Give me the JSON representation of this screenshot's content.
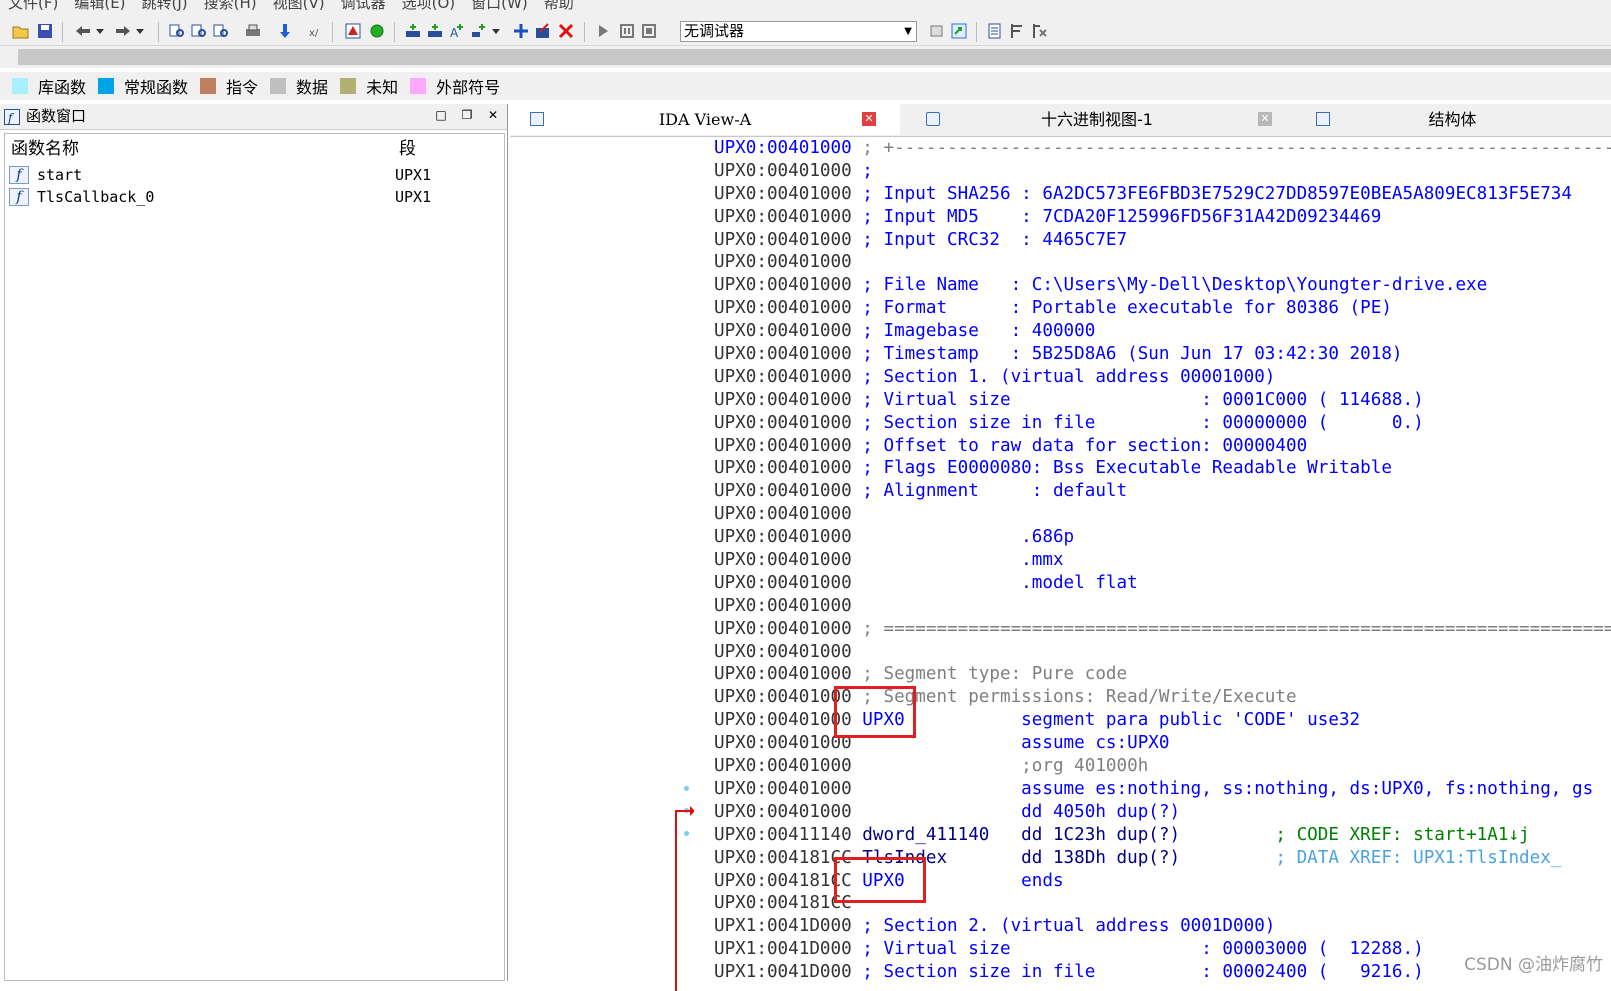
{
  "menu": [
    "文件(F)",
    "编辑(E)",
    "跳转(J)",
    "搜索(H)",
    "视图(V)",
    "调试器",
    "选项(O)",
    "窗口(W)",
    "帮助"
  ],
  "toolbar": {
    "debugger_select": "无调试器"
  },
  "legend": [
    {
      "label": "库函数",
      "color": "#a8f0ff"
    },
    {
      "label": "常规函数",
      "color": "#00a2e8"
    },
    {
      "label": "指令",
      "color": "#c08060"
    },
    {
      "label": "数据",
      "color": "#c0c0c0"
    },
    {
      "label": "未知",
      "color": "#b0b070"
    },
    {
      "label": "外部符号",
      "color": "#ffa8ff"
    }
  ],
  "func_window": {
    "title": "函数窗口",
    "col_name": "函数名称",
    "col_seg": "段",
    "rows": [
      {
        "name": "start",
        "seg": "UPX1"
      },
      {
        "name": "TlsCallback_0",
        "seg": "UPX1"
      }
    ]
  },
  "tabs": [
    "IDA View-A",
    "十六进制视图-1",
    "结构体"
  ],
  "listing": [
    {
      "a": "UPX0:00401000",
      "t": " ; +-----------------------------------------------------------------------",
      "c": "gry",
      "first": true
    },
    {
      "a": "UPX0:00401000",
      "t": " ;",
      "c": "blu"
    },
    {
      "a": "UPX0:00401000",
      "t": " ; Input SHA256 : 6A2DC573FE6FBD3E7529C27DD8597E0BEA5A809EC813F5E734",
      "c": "blu"
    },
    {
      "a": "UPX0:00401000",
      "t": " ; Input MD5    : 7CDA20F125996FD56F31A42D09234469",
      "c": "blu"
    },
    {
      "a": "UPX0:00401000",
      "t": " ; Input CRC32  : 4465C7E7",
      "c": "blu"
    },
    {
      "a": "UPX0:00401000",
      "t": "",
      "c": "blu"
    },
    {
      "a": "UPX0:00401000",
      "t": " ; File Name   : C:\\Users\\My-Dell\\Desktop\\Youngter-drive.exe",
      "c": "blu"
    },
    {
      "a": "UPX0:00401000",
      "t": " ; Format      : Portable executable for 80386 (PE)",
      "c": "blu"
    },
    {
      "a": "UPX0:00401000",
      "t": " ; Imagebase   : 400000",
      "c": "blu"
    },
    {
      "a": "UPX0:00401000",
      "t": " ; Timestamp   : 5B25D8A6 (Sun Jun 17 03:42:30 2018)",
      "c": "blu"
    },
    {
      "a": "UPX0:00401000",
      "t": " ; Section 1. (virtual address 00001000)",
      "c": "blu"
    },
    {
      "a": "UPX0:00401000",
      "t": " ; Virtual size                  : 0001C000 ( 114688.)",
      "c": "blu"
    },
    {
      "a": "UPX0:00401000",
      "t": " ; Section size in file          : 00000000 (      0.)",
      "c": "blu"
    },
    {
      "a": "UPX0:00401000",
      "t": " ; Offset to raw data for section: 00000400",
      "c": "blu"
    },
    {
      "a": "UPX0:00401000",
      "t": " ; Flags E0000080: Bss Executable Readable Writable",
      "c": "blu"
    },
    {
      "a": "UPX0:00401000",
      "t": " ; Alignment     : default",
      "c": "blu"
    },
    {
      "a": "UPX0:00401000",
      "t": "",
      "c": "blu"
    },
    {
      "a": "UPX0:00401000",
      "t": "                .686p",
      "c": "blu"
    },
    {
      "a": "UPX0:00401000",
      "t": "                .mmx",
      "c": "blu"
    },
    {
      "a": "UPX0:00401000",
      "t": "                .model flat",
      "c": "blu"
    },
    {
      "a": "UPX0:00401000",
      "t": "",
      "c": "blu"
    },
    {
      "a": "UPX0:00401000",
      "t": " ; =========================================================================",
      "c": "gry"
    },
    {
      "a": "UPX0:00401000",
      "t": "",
      "c": "blu"
    },
    {
      "a": "UPX0:00401000",
      "t": " ; Segment type: Pure code",
      "c": "gry"
    },
    {
      "a": "UPX0:00401000",
      "t": " ; Segment permissions: Read/Write/Execute",
      "c": "gry"
    },
    {
      "a": "UPX0:00401000",
      "t": " UPX0           segment para public 'CODE' use32",
      "c": "blu"
    },
    {
      "a": "UPX0:00401000",
      "t": "                assume cs:UPX0",
      "c": "blu"
    },
    {
      "a": "UPX0:00401000",
      "t": "                ;org 401000h",
      "c": "gry"
    },
    {
      "a": "UPX0:00401000",
      "t": "                assume es:nothing, ss:nothing, ds:UPX0, fs:nothing, gs",
      "c": "blu"
    },
    {
      "a": "UPX0:00401000",
      "t": "                dd 4050h dup(?)",
      "c": "blu"
    },
    {
      "a": "UPX0:00411140",
      "t": " dword_411140   dd 1C23h dup(?)         ; CODE XREF: start+1A1↓j",
      "c": "mix1"
    },
    {
      "a": "UPX0:004181CC",
      "t": " TlsIndex       dd 138Dh dup(?)         ; DATA XREF: UPX1:TlsIndex_",
      "c": "mix2"
    },
    {
      "a": "UPX0:004181CC",
      "t": " UPX0           ends",
      "c": "blu"
    },
    {
      "a": "UPX0:004181CC",
      "t": "",
      "c": "blu"
    },
    {
      "a": "UPX1:0041D000",
      "t": " ; Section 2. (virtual address 0001D000)",
      "c": "blu"
    },
    {
      "a": "UPX1:0041D000",
      "t": " ; Virtual size                  : 00003000 (  12288.)",
      "c": "blu"
    },
    {
      "a": "UPX1:0041D000",
      "t": " ; Section size in file          : 00002400 (   9216.)",
      "c": "blu"
    }
  ],
  "watermark": "CSDN @油炸腐竹"
}
